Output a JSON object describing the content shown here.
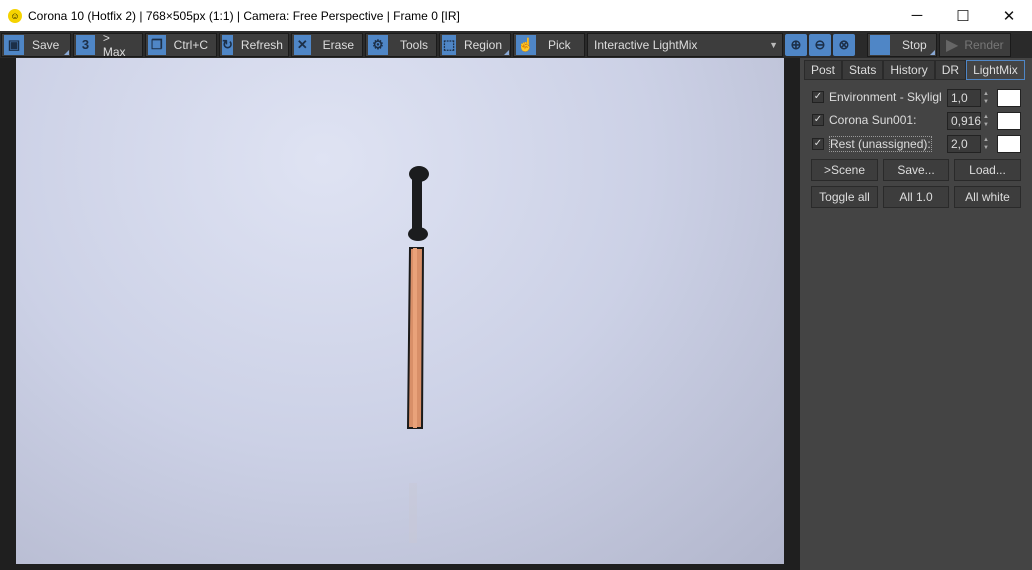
{
  "window": {
    "title": "Corona 10 (Hotfix 2) | 768×505px (1:1) | Camera: Free Perspective | Frame 0 [IR]",
    "minimize": "─",
    "maximize": "☐",
    "close": "✕"
  },
  "toolbar": {
    "save": "Save",
    "max": "> Max",
    "copy": "Ctrl+C",
    "refresh": "Refresh",
    "erase": "Erase",
    "tools": "Tools",
    "region": "Region",
    "pick": "Pick",
    "display_mode": "Interactive LightMix",
    "stop": "Stop",
    "render": "Render"
  },
  "tabs": [
    "Post",
    "Stats",
    "History",
    "DR",
    "LightMix"
  ],
  "active_tab": "LightMix",
  "lightmix": {
    "lights": [
      {
        "name": "Environment - Skyligh",
        "checked": true,
        "value": "1,0",
        "color": "#ffffff"
      },
      {
        "name": "Corona Sun001:",
        "checked": true,
        "value": "0,916",
        "color": "#ffffff"
      },
      {
        "name": "Rest (unassigned):",
        "checked": true,
        "value": "2,0",
        "color": "#ffffff"
      }
    ],
    "buttons": {
      "scene": ">Scene",
      "save": "Save...",
      "load": "Load...",
      "toggle_all": "Toggle all",
      "all_one": "All 1.0",
      "all_white": "All white"
    }
  },
  "colors": {
    "accent": "#4f86c6",
    "panel": "#444444",
    "toolbar": "#2a2a2a"
  }
}
